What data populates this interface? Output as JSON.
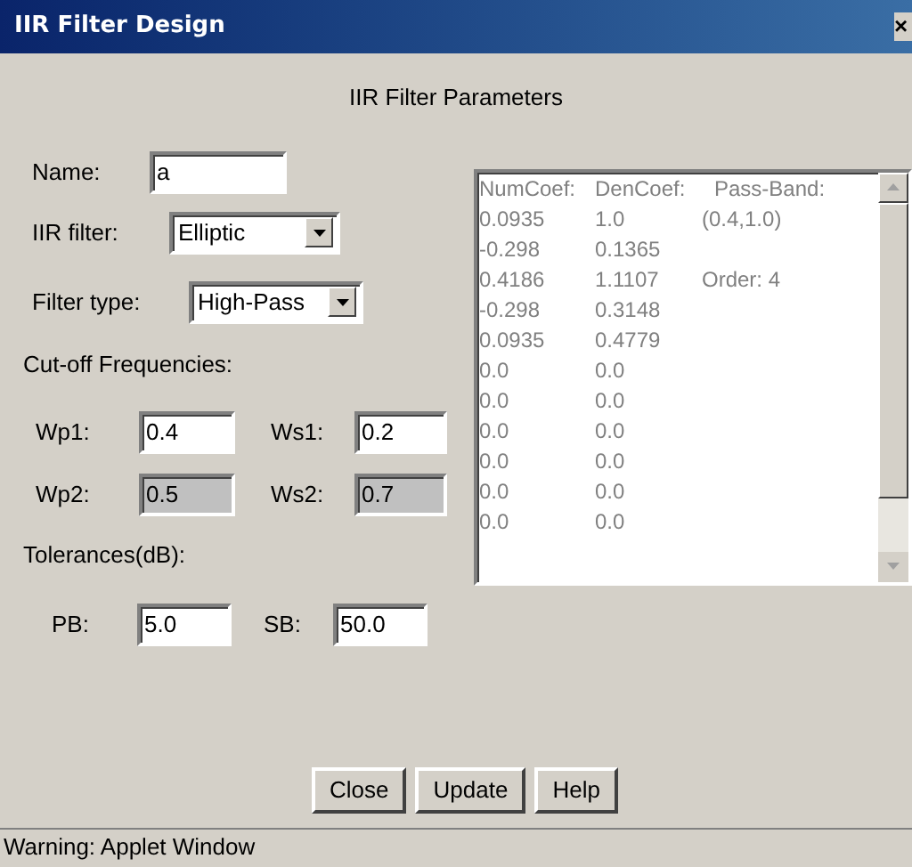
{
  "window": {
    "title": "IIR Filter Design",
    "close": "×"
  },
  "heading": "IIR Filter Parameters",
  "name": {
    "label": "Name:",
    "value": "a"
  },
  "iir_filter": {
    "label": "IIR filter:",
    "value": "Elliptic"
  },
  "filter_type": {
    "label": "Filter type:",
    "value": "High-Pass"
  },
  "cutoff": {
    "label": "Cut-off Frequencies:",
    "fields": [
      {
        "label": "Wp1:",
        "value": "0.4",
        "disabled": false
      },
      {
        "label": "Ws1:",
        "value": "0.2",
        "disabled": false
      },
      {
        "label": "Wp2:",
        "value": "0.5",
        "disabled": true
      },
      {
        "label": "Ws2:",
        "value": "0.7",
        "disabled": true
      }
    ]
  },
  "tolerances": {
    "label": "Tolerances(dB):",
    "fields": [
      {
        "label": "PB:",
        "value": "5.0"
      },
      {
        "label": "SB:",
        "value": "50.0"
      }
    ]
  },
  "output": {
    "lines": [
      [
        "NumCoef:",
        "DenCoef:",
        "Pass-Band:"
      ],
      [
        "0.0935",
        "1.0",
        "(0.4,1.0)"
      ],
      [
        "-0.298",
        "0.1365"
      ],
      [
        "0.4186",
        "1.1107",
        "Order: 4"
      ],
      [
        "-0.298",
        "0.3148"
      ],
      [
        "0.0935",
        "0.4779"
      ],
      [
        "0.0",
        "0.0"
      ],
      [
        "0.0",
        "0.0"
      ],
      [
        "0.0",
        "0.0"
      ],
      [
        "0.0",
        "0.0"
      ],
      [
        "0.0",
        "0.0"
      ],
      [
        "0.0",
        "0.0"
      ]
    ]
  },
  "buttons": [
    "Close",
    "Update",
    "Help"
  ],
  "status_bar": "Warning: Applet Window"
}
